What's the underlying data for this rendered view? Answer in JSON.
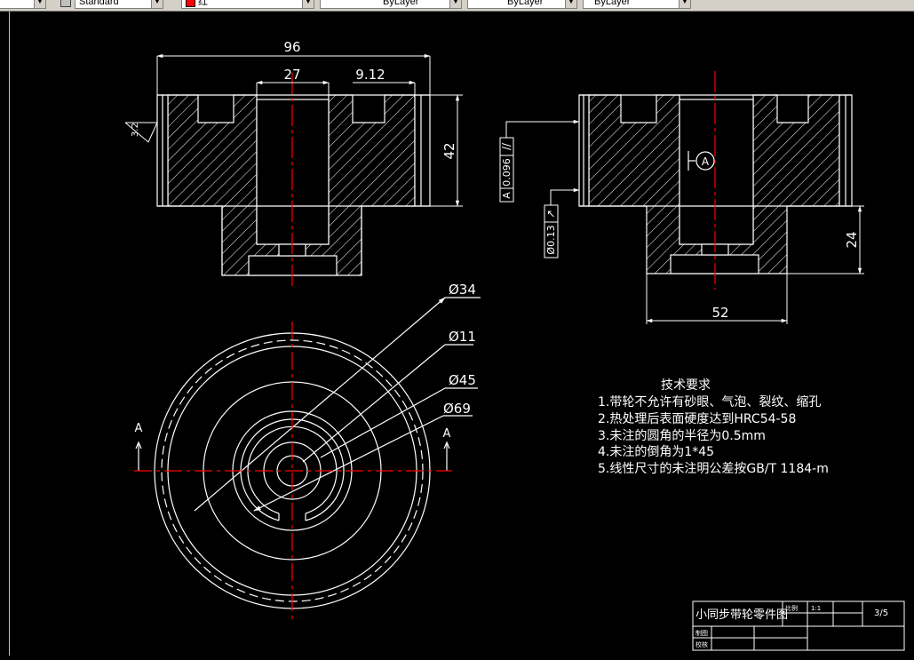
{
  "toolbar": {
    "text_style": "Standard",
    "color": "红",
    "linetype": "ByLayer",
    "lineweight": "ByLayer",
    "plot_style": "ByLayer"
  },
  "colors": {
    "background": "#000000",
    "geometry": "#ffffff",
    "centerline": "#ff0000"
  },
  "dims": {
    "d96": "96",
    "d27": "27",
    "d912": "9.12",
    "d42": "42",
    "d24": "24",
    "d52": "52",
    "phi34": "Ø34",
    "phi11": "Ø11",
    "phi45": "Ø45",
    "phi69": "Ø69",
    "rough": "3.2",
    "section_left": "A",
    "section_right": "A",
    "datum": "A"
  },
  "tolerances": {
    "parallel": {
      "value": "0.096",
      "datum": "A"
    },
    "runout": {
      "value": "Ø0.13"
    }
  },
  "tech": {
    "title": "技术要求",
    "items": [
      "1.带轮不允许有砂眼、气泡、裂纹、缩孔",
      "2.热处理后表面硬度达到HRC54-58",
      "3.未注的圆角的半径为0.5mm",
      "4.未注的倒角为1*45",
      "5.线性尺寸的未注明公差按GB/T 1184-m"
    ]
  },
  "title_block": {
    "name": "小同步带轮零件图",
    "scale_label": "比例",
    "scale": "1:1",
    "sheet": "3/5",
    "drawn": "制图",
    "checked": "校核"
  }
}
